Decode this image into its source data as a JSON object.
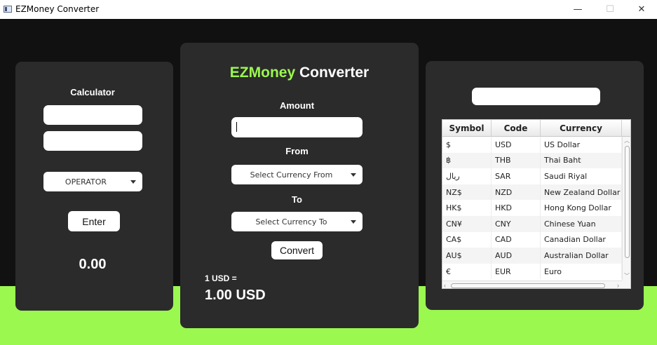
{
  "window": {
    "title": "EZMoney Converter",
    "minimize_glyph": "—",
    "maximize_glyph": "☐",
    "close_glyph": "✕"
  },
  "colors": {
    "accent_green": "#9af84f",
    "panel": "#2b2b2b",
    "background": "#111111"
  },
  "calculator": {
    "title": "Calculator",
    "input1_value": "",
    "input2_value": "",
    "operator_label": "OPERATOR",
    "enter_label": "Enter",
    "result": "0.00"
  },
  "converter": {
    "title_brand": "EZMoney",
    "title_rest": "Converter",
    "amount_label": "Amount",
    "amount_value": "",
    "from_label": "From",
    "from_select": "Select Currency From",
    "to_label": "To",
    "to_select": "Select Currency To",
    "convert_label": "Convert",
    "rate_text": "1 USD =",
    "result_text": "1.00 USD"
  },
  "currency_panel": {
    "search_value": "",
    "columns": [
      "Symbol",
      "Code",
      "Currency"
    ],
    "rows": [
      {
        "symbol": "$",
        "code": "USD",
        "name": "US Dollar"
      },
      {
        "symbol": "฿",
        "code": "THB",
        "name": "Thai Baht"
      },
      {
        "symbol": "ريال",
        "code": "SAR",
        "name": "Saudi Riyal"
      },
      {
        "symbol": "NZ$",
        "code": "NZD",
        "name": "New Zealand Dollar"
      },
      {
        "symbol": "HK$",
        "code": "HKD",
        "name": "Hong Kong Dollar"
      },
      {
        "symbol": "CN¥",
        "code": "CNY",
        "name": "Chinese Yuan"
      },
      {
        "symbol": "CA$",
        "code": "CAD",
        "name": "Canadian Dollar"
      },
      {
        "symbol": "AU$",
        "code": "AUD",
        "name": "Australian Dollar"
      },
      {
        "symbol": "€",
        "code": "EUR",
        "name": "Euro"
      }
    ]
  }
}
